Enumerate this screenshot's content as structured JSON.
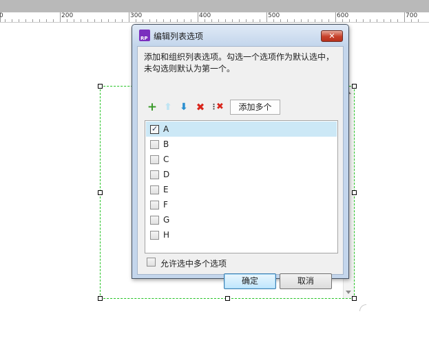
{
  "ruler": {
    "labels": [
      "0",
      "200",
      "300",
      "400",
      "500",
      "600",
      "700"
    ]
  },
  "dialog": {
    "title": "编辑列表选项",
    "app_icon_text": "RP",
    "close_icon": "close-x-icon",
    "description_line1": "添加和组织列表选项。勾选一个选项作为默认选中，",
    "description_line2": "未勾选则默认为第一个。",
    "toolbar": {
      "add_icon": "plus-icon",
      "move_up_icon": "arrow-up-icon",
      "move_down_icon": "arrow-down-icon",
      "delete_icon": "delete-x-icon",
      "delete_all_icon": "delete-all-icon",
      "add_multiple_label": "添加多个"
    },
    "items": [
      {
        "label": "A",
        "checked": true
      },
      {
        "label": "B",
        "checked": false
      },
      {
        "label": "C",
        "checked": false
      },
      {
        "label": "D",
        "checked": false
      },
      {
        "label": "E",
        "checked": false
      },
      {
        "label": "F",
        "checked": false
      },
      {
        "label": "G",
        "checked": false
      },
      {
        "label": "H",
        "checked": false
      }
    ],
    "allow_multiple_label": "允许选中多个选项",
    "ok_label": "确定",
    "cancel_label": "取消"
  },
  "colors": {
    "selection_border": "#22c322",
    "list_selected": "#cce8f6",
    "add_icon": "#3a9a2a",
    "move_up_icon": "#bfe4f3",
    "move_down_icon": "#2a8fd0",
    "delete_icon": "#d9261c"
  }
}
